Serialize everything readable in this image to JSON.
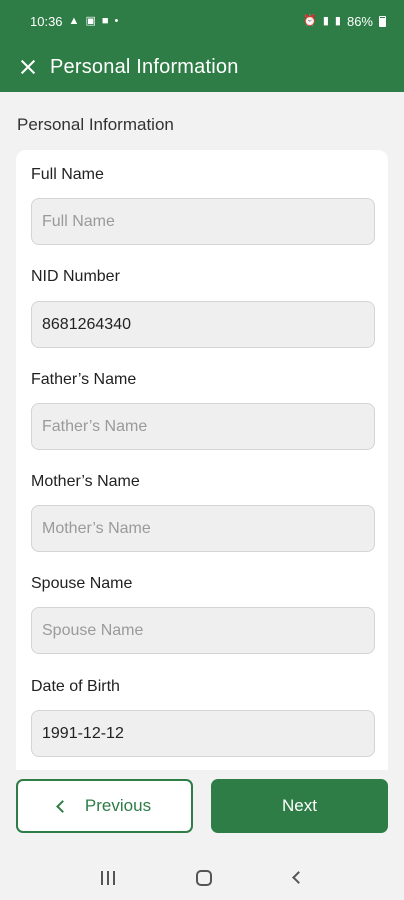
{
  "status_bar": {
    "time": "10:36",
    "battery": "86%"
  },
  "app_bar": {
    "title": "Personal Information"
  },
  "section": {
    "title": "Personal Information"
  },
  "fields": [
    {
      "label": "Full Name",
      "value": "",
      "placeholder": "Full Name"
    },
    {
      "label": "NID Number",
      "value": "8681264340",
      "placeholder": ""
    },
    {
      "label": "Father’s Name",
      "value": "",
      "placeholder": "Father’s Name"
    },
    {
      "label": "Mother’s Name",
      "value": "",
      "placeholder": "Mother’s Name"
    },
    {
      "label": "Spouse Name",
      "value": "",
      "placeholder": "Spouse Name"
    },
    {
      "label": "Date of Birth",
      "value": "1991-12-12",
      "placeholder": ""
    }
  ],
  "buttons": {
    "previous": "Previous",
    "next": "Next"
  },
  "colors": {
    "primary": "#2e7d46",
    "background": "#f2f2f2",
    "input_bg": "#efefef"
  }
}
